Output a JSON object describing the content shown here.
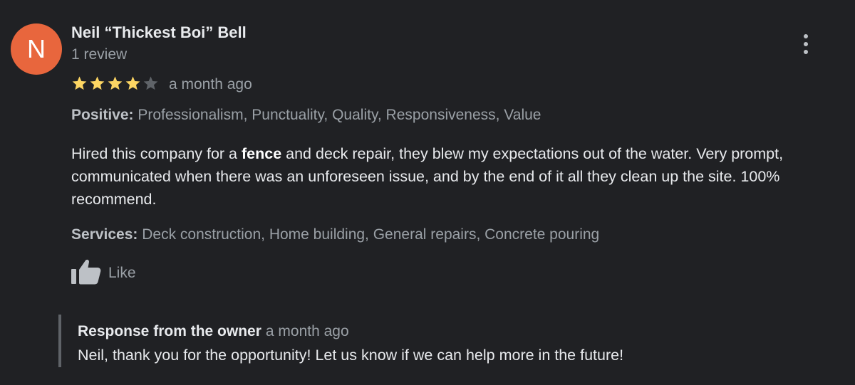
{
  "reviewer": {
    "avatar_letter": "N",
    "avatar_color": "#e8663d",
    "name": "Neil “Thickest Boi” Bell",
    "review_count": "1 review"
  },
  "menu": {
    "icon": "more-vertical-icon"
  },
  "rating": {
    "stars": 4,
    "max_stars": 5,
    "filled_color": "#fdd663",
    "empty_color": "#5f6368",
    "date": "a month ago"
  },
  "positive": {
    "label": "Positive:",
    "value": " Professionalism, Punctuality, Quality, Responsiveness, Value"
  },
  "body": {
    "before_bold": "Hired this company for a ",
    "bold": "fence",
    "after_bold": " and deck repair, they blew my expectations out of the water. Very prompt, communicated when there was an unforeseen issue, and by the end of it all they clean up the site. 100% recommend."
  },
  "services": {
    "label": "Services:",
    "value": " Deck construction, Home building, General repairs, Concrete pouring"
  },
  "like": {
    "icon": "thumbs-up-icon",
    "label": "Like"
  },
  "owner_response": {
    "title": "Response from the owner",
    "date": "a month ago",
    "text": "Neil, thank you for the opportunity! Let us know if we can help more in the future!"
  }
}
